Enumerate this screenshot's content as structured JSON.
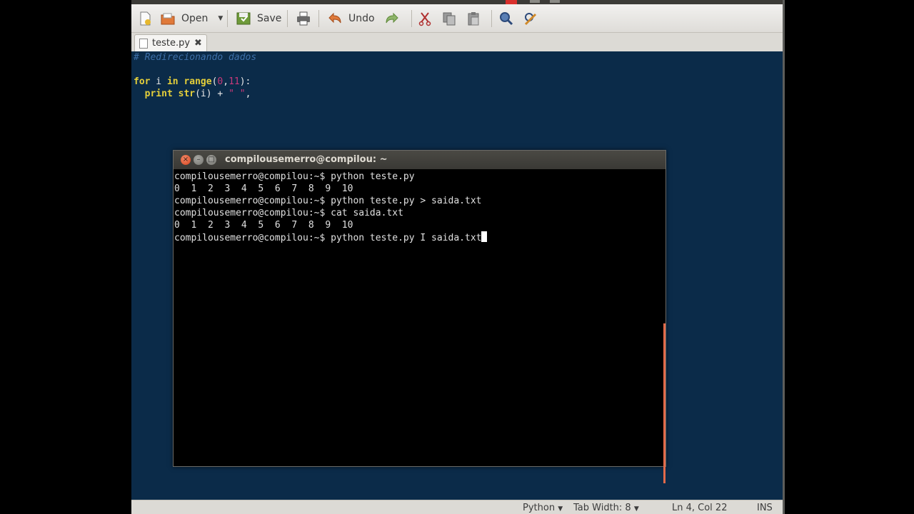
{
  "toolbar": {
    "open_label": "Open",
    "save_label": "Save",
    "undo_label": "Undo"
  },
  "tab": {
    "label": "teste.py"
  },
  "editor": {
    "comment": "# Redirecionando dados",
    "line3": {
      "kw_for": "for",
      "var": " i ",
      "kw_in": "in",
      "fn_range": " range",
      "paren_open": "(",
      "num0": "0",
      "comma": ",",
      "num11": "11",
      "paren_close": "):"
    },
    "line4": {
      "indent": "  ",
      "kw_print": "print",
      "fn_str": " str",
      "rest": "(i) + ",
      "str_lit": "\" \"",
      "tail": ","
    }
  },
  "terminal": {
    "title": "compilousemerro@compilou: ~",
    "lines": [
      "compilousemerro@compilou:~$ python teste.py",
      "0  1  2  3  4  5  6  7  8  9  10",
      "compilousemerro@compilou:~$ python teste.py > saida.txt",
      "compilousemerro@compilou:~$ cat saida.txt",
      "0  1  2  3  4  5  6  7  8  9  10",
      "compilousemerro@compilou:~$ python teste.py I saida.txt"
    ]
  },
  "statusbar": {
    "language": "Python",
    "tab_width": "Tab Width:  8",
    "position": "Ln 4, Col 22",
    "mode": "INS"
  },
  "colors": {
    "editor_bg": "#0b2b49",
    "keyword": "#e5cf3a",
    "number": "#c9397a",
    "comment": "#3d6fa8",
    "close_button": "#d8431c"
  }
}
